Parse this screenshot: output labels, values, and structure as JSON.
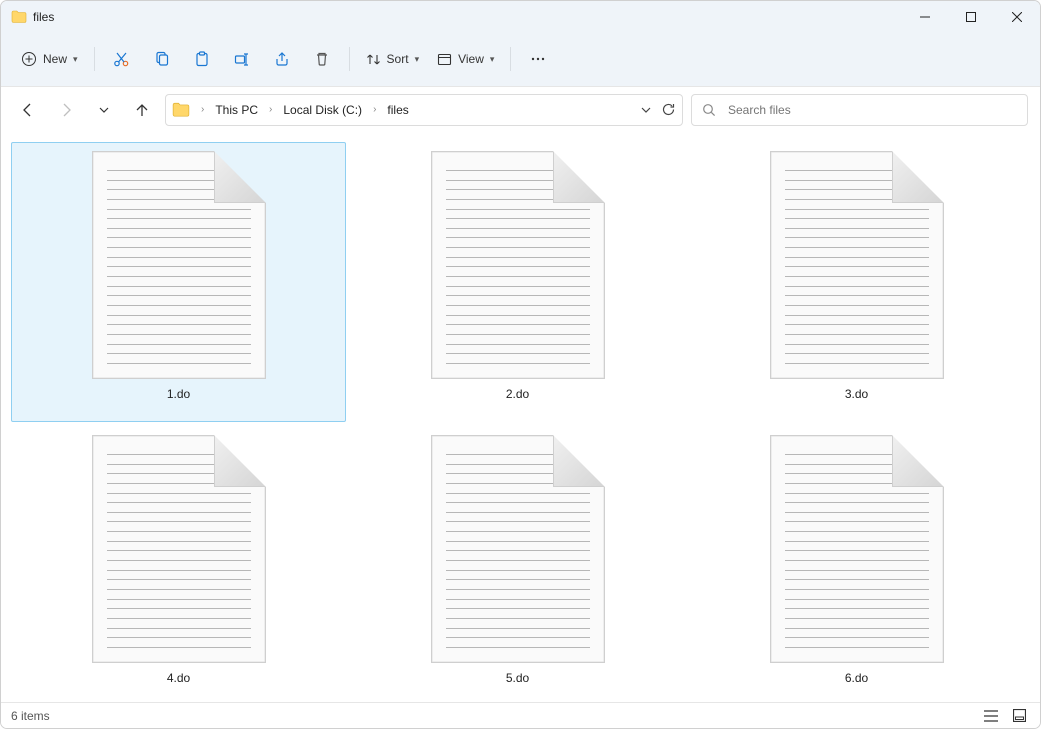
{
  "titlebar": {
    "title": "files"
  },
  "toolbar": {
    "new_label": "New",
    "sort_label": "Sort",
    "view_label": "View"
  },
  "breadcrumbs": {
    "c0": "This PC",
    "c1": "Local Disk (C:)",
    "c2": "files"
  },
  "search": {
    "placeholder": "Search files"
  },
  "files": {
    "f0": "1.do",
    "f1": "2.do",
    "f2": "3.do",
    "f3": "4.do",
    "f4": "5.do",
    "f5": "6.do"
  },
  "status": {
    "count": "6 items"
  }
}
